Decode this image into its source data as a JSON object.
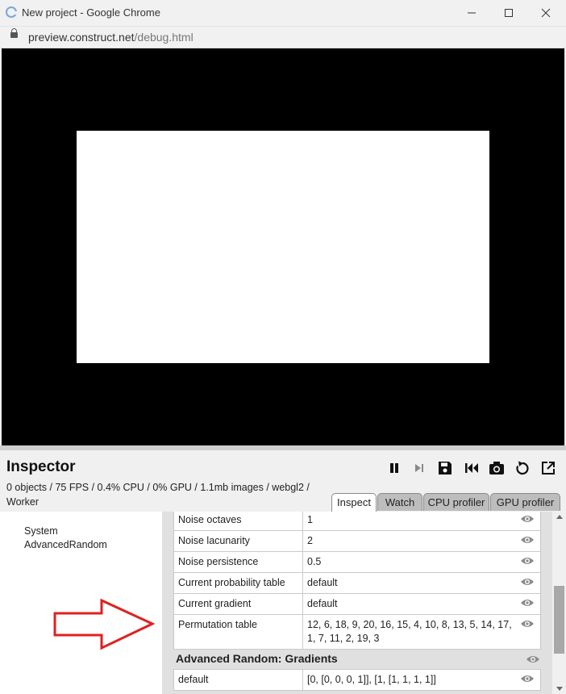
{
  "window": {
    "title": "New project - Google Chrome",
    "url_host": "preview.construct.net",
    "url_path": "/debug.html",
    "minimize_icon": "minimize-icon",
    "maximize_icon": "maximize-icon",
    "close_icon": "close-icon"
  },
  "inspector": {
    "title": "Inspector",
    "stats_line1": "0 objects / 75 FPS / 0.4% CPU / 0% GPU / 1.1mb images / webgl2 /",
    "stats_line2": "Worker",
    "toolbar": [
      "pause-icon",
      "step-icon",
      "save-icon",
      "restart-icon",
      "screenshot-icon",
      "reload-icon",
      "popout-icon"
    ],
    "tabs": [
      "Inspect",
      "Watch",
      "CPU profiler",
      "GPU profiler"
    ],
    "active_tab": "Inspect"
  },
  "tree": {
    "items": [
      "System",
      "AdvancedRandom"
    ]
  },
  "properties": {
    "rows": [
      {
        "key": "Noise octaves",
        "value": "1"
      },
      {
        "key": "Noise lacunarity",
        "value": "2"
      },
      {
        "key": "Noise persistence",
        "value": "0.5"
      },
      {
        "key": "Current probability table",
        "value": "default"
      },
      {
        "key": "Current gradient",
        "value": "default"
      },
      {
        "key": "Permutation table",
        "value": "12, 6, 18, 9, 20, 16, 15, 4, 10, 8, 13, 5, 14, 17, 1, 7, 11, 2, 19, 3"
      }
    ],
    "section_title": "Advanced Random: Gradients",
    "section_rows": [
      {
        "key": "default",
        "value": "[0, [0, 0, 0, 1]], [1, [1, 1, 1, 1]]"
      }
    ]
  },
  "colors": {
    "arrow": "#e02020",
    "viewport": "#000000",
    "canvas": "#ffffff"
  }
}
